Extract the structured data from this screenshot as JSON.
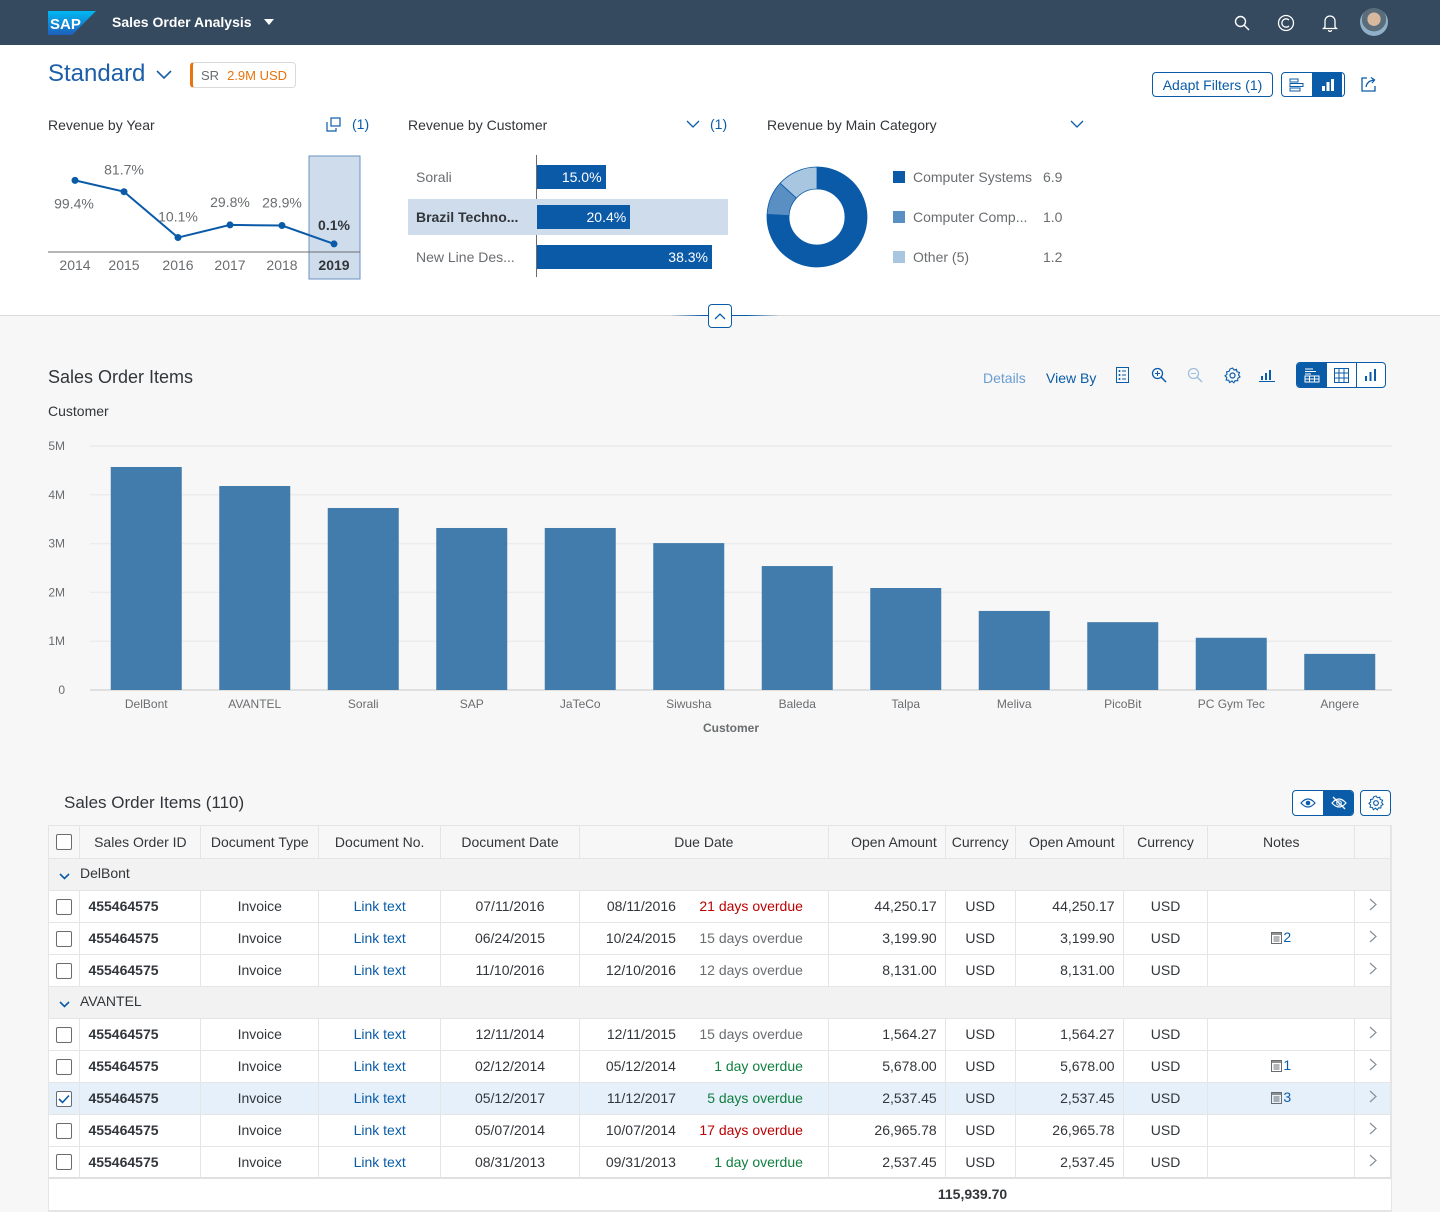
{
  "shell": {
    "brand": "SAP",
    "app_title": "Sales Order Analysis",
    "icons": [
      "search-icon",
      "copilot-icon",
      "notification-bell-icon",
      "user-avatar"
    ]
  },
  "header": {
    "variant": "Standard",
    "kpi": {
      "label": "SR",
      "value": "2.9M USD",
      "color": "#e9730c"
    },
    "adapt_filters": "Adapt Filters (1)",
    "view_toggle": [
      "visual-filter-list",
      "visual-filter-chart"
    ],
    "share_icon": "share-icon"
  },
  "cards": {
    "year": {
      "title": "Revenue by Year",
      "count": "(1)",
      "categories": [
        "2014",
        "2015",
        "2016",
        "2017",
        "2018",
        "2019"
      ],
      "labels": [
        "99.4%",
        "81.7%",
        "10.1%",
        "29.8%",
        "28.9%",
        "0.1%"
      ],
      "values": [
        99.4,
        81.7,
        10.1,
        29.8,
        28.9,
        0.1
      ],
      "selected": "2019"
    },
    "customer": {
      "title": "Revenue by Customer",
      "count": "(1)",
      "rows": [
        {
          "label": "Sorali",
          "value": 15.0,
          "text": "15.0%",
          "selected": false
        },
        {
          "label": "Brazil Techno...",
          "value": 20.4,
          "text": "20.4%",
          "selected": true
        },
        {
          "label": "New Line Des...",
          "value": 38.3,
          "text": "38.3%",
          "selected": false
        }
      ]
    },
    "category": {
      "title": "Revenue by Main Category",
      "items": [
        {
          "label": "Computer Systems",
          "value": 6.9,
          "text": "6.9",
          "color": "#0a5aa8"
        },
        {
          "label": "Computer Comp...",
          "value": 1.0,
          "text": "1.0",
          "color": "#5a8fc3"
        },
        {
          "label": "Other (5)",
          "value": 1.2,
          "text": "1.2",
          "color": "#a9c6e0"
        }
      ]
    }
  },
  "analysis": {
    "title": "Sales Order Items",
    "details": "Details",
    "view_by": "View By",
    "chart_title": "Customer"
  },
  "chart_data": {
    "type": "bar",
    "title": "Customer",
    "xlabel": "Customer",
    "ylabel": "",
    "categories": [
      "DelBont",
      "AVANTEL",
      "Sorali",
      "SAP",
      "JaTeCo",
      "Siwusha",
      "Baleda",
      "Talpa",
      "Meliva",
      "PicoBit",
      "PC Gym Tec",
      "Angere"
    ],
    "values": [
      4.57,
      4.18,
      3.73,
      3.32,
      3.32,
      3.01,
      2.54,
      2.09,
      1.62,
      1.39,
      1.07,
      0.74
    ],
    "unit": "M",
    "yticks": [
      "0",
      "1M",
      "2M",
      "3M",
      "4M",
      "5M"
    ],
    "ylim": [
      0,
      5
    ],
    "grid": true,
    "color": "#427cac"
  },
  "table": {
    "title": "Sales Order Items (110)",
    "columns": [
      "Sales Order ID",
      "Document Type",
      "Document No.",
      "Document Date",
      "Due Date",
      "Open Amount",
      "Currency",
      "Open Amount",
      "Currency",
      "Notes"
    ],
    "groups": [
      {
        "name": "DelBont",
        "rows": [
          {
            "id": "455464575",
            "type": "Invoice",
            "doc": "Link text",
            "date": "07/11/2016",
            "due": "08/11/2016",
            "status": "21 days overdue",
            "state": "neg",
            "amt": "44,250.17",
            "cur": "USD",
            "amt2": "44,250.17",
            "cur2": "USD",
            "notes": "",
            "checked": false
          },
          {
            "id": "455464575",
            "type": "Invoice",
            "doc": "Link text",
            "date": "06/24/2015",
            "due": "10/24/2015",
            "status": "15 days overdue",
            "state": "neu",
            "amt": "3,199.90",
            "cur": "USD",
            "amt2": "3,199.90",
            "cur2": "USD",
            "notes": "2",
            "checked": false
          },
          {
            "id": "455464575",
            "type": "Invoice",
            "doc": "Link text",
            "date": "11/10/2016",
            "due": "12/10/2016",
            "status": "12 days overdue",
            "state": "neu",
            "amt": "8,131.00",
            "cur": "USD",
            "amt2": "8,131.00",
            "cur2": "USD",
            "notes": "",
            "checked": false
          }
        ]
      },
      {
        "name": "AVANTEL",
        "rows": [
          {
            "id": "455464575",
            "type": "Invoice",
            "doc": "Link text",
            "date": "12/11/2014",
            "due": "12/11/2015",
            "status": "15 days overdue",
            "state": "neu",
            "amt": "1,564.27",
            "cur": "USD",
            "amt2": "1,564.27",
            "cur2": "USD",
            "notes": "",
            "checked": false
          },
          {
            "id": "455464575",
            "type": "Invoice",
            "doc": "Link text",
            "date": "02/12/2014",
            "due": "05/12/2014",
            "status": "1 day overdue",
            "state": "pos",
            "amt": "5,678.00",
            "cur": "USD",
            "amt2": "5,678.00",
            "cur2": "USD",
            "notes": "1",
            "checked": false
          },
          {
            "id": "455464575",
            "type": "Invoice",
            "doc": "Link text",
            "date": "05/12/2017",
            "due": "11/12/2017",
            "status": "5 days overdue",
            "state": "pos",
            "amt": "2,537.45",
            "cur": "USD",
            "amt2": "2,537.45",
            "cur2": "USD",
            "notes": "3",
            "checked": true
          },
          {
            "id": "455464575",
            "type": "Invoice",
            "doc": "Link text",
            "date": "05/07/2014",
            "due": "10/07/2014",
            "status": "17 days overdue",
            "state": "neg",
            "amt": "26,965.78",
            "cur": "USD",
            "amt2": "26,965.78",
            "cur2": "USD",
            "notes": "",
            "checked": false
          },
          {
            "id": "455464575",
            "type": "Invoice",
            "doc": "Link text",
            "date": "08/31/2013",
            "due": "09/31/2013",
            "status": "1 day overdue",
            "state": "pos",
            "amt": "2,537.45",
            "cur": "USD",
            "amt2": "2,537.45",
            "cur2": "USD",
            "notes": "",
            "checked": false
          }
        ]
      }
    ],
    "total": "115,939.70"
  }
}
